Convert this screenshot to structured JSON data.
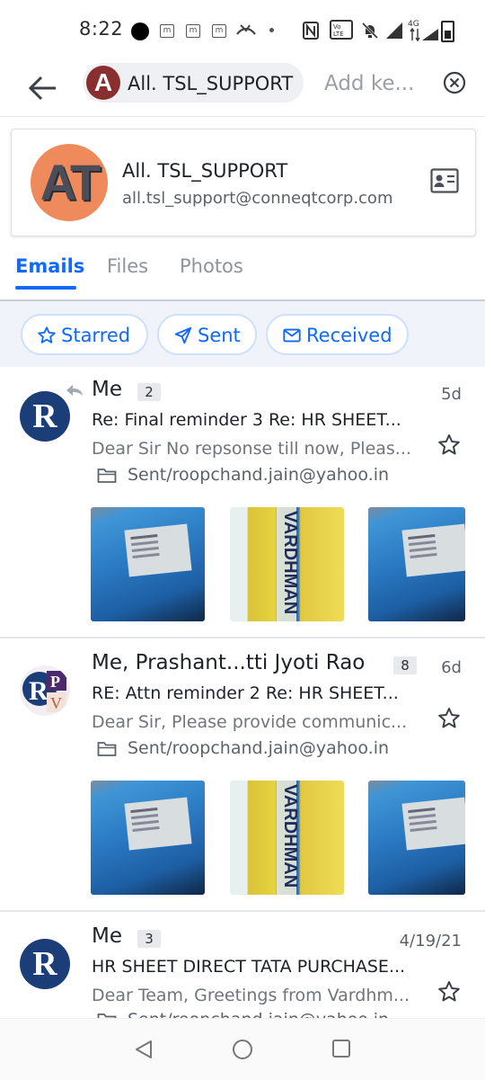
{
  "status_bar": {
    "time": "8:22",
    "indicators": [
      "m",
      "m",
      "m"
    ],
    "network_badge": "4G"
  },
  "header": {
    "back_icon": "arrow-left-icon",
    "contact_chip": {
      "avatar_letter": "A",
      "label": "All. TSL_SUPPORT"
    },
    "keyword_placeholder": "Add ke...",
    "clear_icon": "circle-x-icon"
  },
  "contact_card": {
    "avatar_text": "AT",
    "name": "All. TSL_SUPPORT",
    "email": "all.tsl_support@conneqtcorp.com",
    "card_icon": "contact-card-icon"
  },
  "tabs": [
    {
      "label": "Emails",
      "active": true
    },
    {
      "label": "Files",
      "active": false
    },
    {
      "label": "Photos",
      "active": false
    }
  ],
  "filters": [
    {
      "label": "Starred",
      "icon": "star-outline-icon"
    },
    {
      "label": "Sent",
      "icon": "paper-plane-icon"
    },
    {
      "label": "Received",
      "icon": "envelope-icon"
    }
  ],
  "messages": [
    {
      "sender": "Me",
      "count": "2",
      "date": "5d",
      "replied": true,
      "subject": "Re: Final reminder 3 Re: HR SHEET...",
      "preview": "Dear Sir No repsonse till now, Pleas...",
      "folder": "Sent/roopchand.jain@yahoo.in",
      "avatar": "R",
      "flyer_text": "VARDHMAN AGENCIES"
    },
    {
      "sender": "Me, Prashant...tti Jyoti Rao",
      "count": "8",
      "date": "6d",
      "replied": false,
      "subject": "RE: Attn reminder 2 Re: HR SHEET...",
      "preview": "Dear Sir, Please provide communic...",
      "folder": "Sent/roopchand.jain@yahoo.in",
      "avatar": "RPV",
      "flyer_text": "VARDHMAN AGENCIES"
    },
    {
      "sender": "Me",
      "count": "3",
      "date": "4/19/21",
      "replied": false,
      "subject": "HR SHEET DIRECT TATA PURCHASE...",
      "preview": "Dear Team, Greetings from Vardhm...",
      "folder": "Sent/roopchand.jain@yahoo.in",
      "avatar": "R"
    }
  ],
  "nav_bar": {
    "back": "triangle-back-icon",
    "home": "circle-home-icon",
    "recents": "square-recents-icon"
  },
  "colors": {
    "accent": "#0f69ff",
    "avatar_blue": "#1b3d78",
    "filter_bg": "#f0f3fa"
  }
}
